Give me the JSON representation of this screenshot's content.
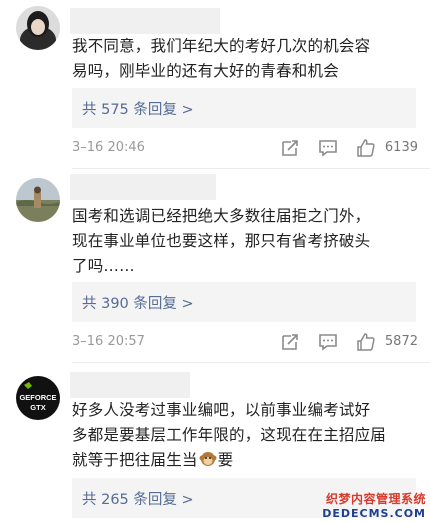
{
  "comments": [
    {
      "text_lines": [
        "我不同意，我们年纪大的考好几次的机会容",
        "易吗，刚毕业的还有大好的青春和机会"
      ],
      "replies_label": "共 575 条回复 >",
      "time": "3–16 20:46",
      "likes": "6139",
      "avatar_icon": "user-avatar-dark-hair"
    },
    {
      "text_lines": [
        "国考和选调已经把绝大多数往届拒之门外，",
        "现在事业单位也要这样，那只有省考挤破头",
        "了吗……"
      ],
      "replies_label": "共 390 条回复 >",
      "time": "3–16 20:57",
      "likes": "5872",
      "avatar_icon": "user-avatar-landscape"
    },
    {
      "text_lines": [
        "好多人没考过事业编吧，以前事业编考试好",
        "多都是要基层工作年限的，这现在在主招应届",
        "就等于把往届生当",
        "要"
      ],
      "emoji_icon": "monkey-emoji-icon",
      "replies_label": "共 265 条回复 >",
      "avatar_icon": "geforce-gtx-logo",
      "avatar_text": [
        "GEFORCE",
        "GTX"
      ]
    }
  ],
  "icons": {
    "share": "share-icon",
    "comment": "comment-icon",
    "like": "thumbs-up-icon"
  },
  "watermark": {
    "line1": "织梦内容管理系统",
    "line2": "DEDECMS.COM"
  },
  "colors": {
    "link": "#566b95",
    "reply_bg": "#f4f4f4",
    "meta": "#9a9a9a"
  }
}
